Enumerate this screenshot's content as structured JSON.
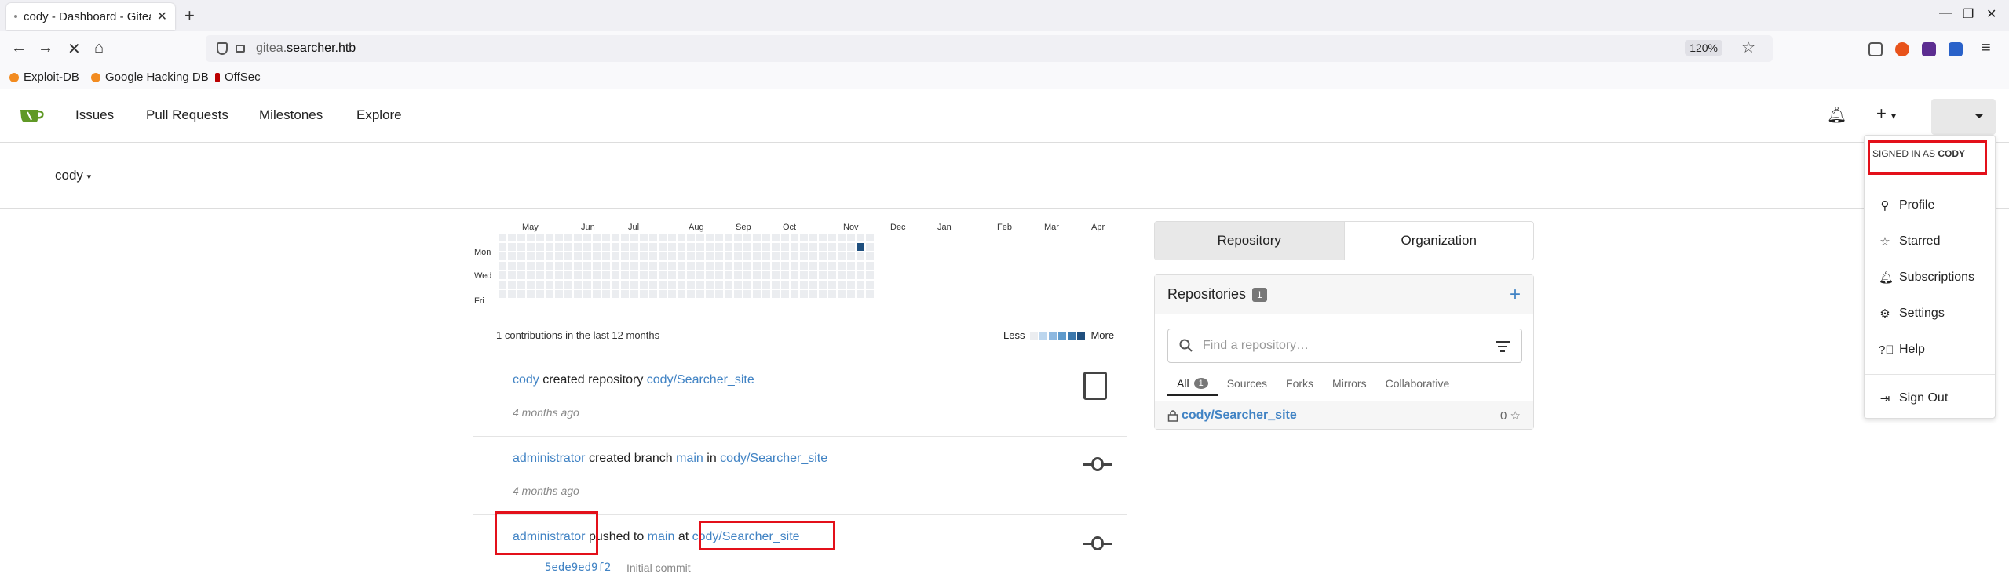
{
  "browser": {
    "tab_title": "cody - Dashboard - Gitea",
    "url_prefix": "gitea.",
    "url_host": "searcher.htb",
    "zoom": "120%",
    "bookmarks": [
      "Exploit-DB",
      "Google Hacking DB",
      "OffSec"
    ]
  },
  "nav": {
    "items": [
      "Issues",
      "Pull Requests",
      "Milestones",
      "Explore"
    ]
  },
  "context_user": "cody",
  "heatmap": {
    "months": [
      "May",
      "Jun",
      "Jul",
      "Aug",
      "Sep",
      "Oct",
      "Nov",
      "Dec",
      "Jan",
      "Feb",
      "Mar",
      "Apr"
    ],
    "days": [
      "Mon",
      "Wed",
      "Fri"
    ],
    "summary": "1 contributions in the last 12 months",
    "less": "Less",
    "more": "More",
    "active_week": 38,
    "active_day": 1,
    "colors": [
      "#ebedf0",
      "#bcd6ee",
      "#8db8e0",
      "#5e9acc",
      "#3b78ad",
      "#1f4f7e"
    ]
  },
  "feed": [
    {
      "user": "cody",
      "action": "created repository",
      "repo": "cody/Searcher_site",
      "time": "4 months ago"
    },
    {
      "user": "administrator",
      "action": "created branch",
      "branch": "main",
      "in": "in",
      "repo": "cody/Searcher_site",
      "time": "4 months ago"
    },
    {
      "user": "administrator",
      "action": "pushed to",
      "branch": "main",
      "at": "at",
      "repo": "cody/Searcher_site",
      "commit_hash": "5ede9ed9f2",
      "commit_msg": "Initial commit"
    }
  ],
  "side": {
    "tab_repository": "Repository",
    "tab_organization": "Organization",
    "repos_title": "Repositories",
    "repos_count": "1",
    "search_placeholder": "Find a repository…",
    "filters": [
      "All",
      "Sources",
      "Forks",
      "Mirrors",
      "Collaborative"
    ],
    "all_count": "1",
    "repo_name": "cody/Searcher_site",
    "repo_stars": "0"
  },
  "dropdown": {
    "signed_in_prefix": "SIGNED IN AS",
    "signed_in_user": "CODY",
    "items": [
      "Profile",
      "Starred",
      "Subscriptions",
      "Settings",
      "Help"
    ],
    "sign_out": "Sign Out"
  }
}
